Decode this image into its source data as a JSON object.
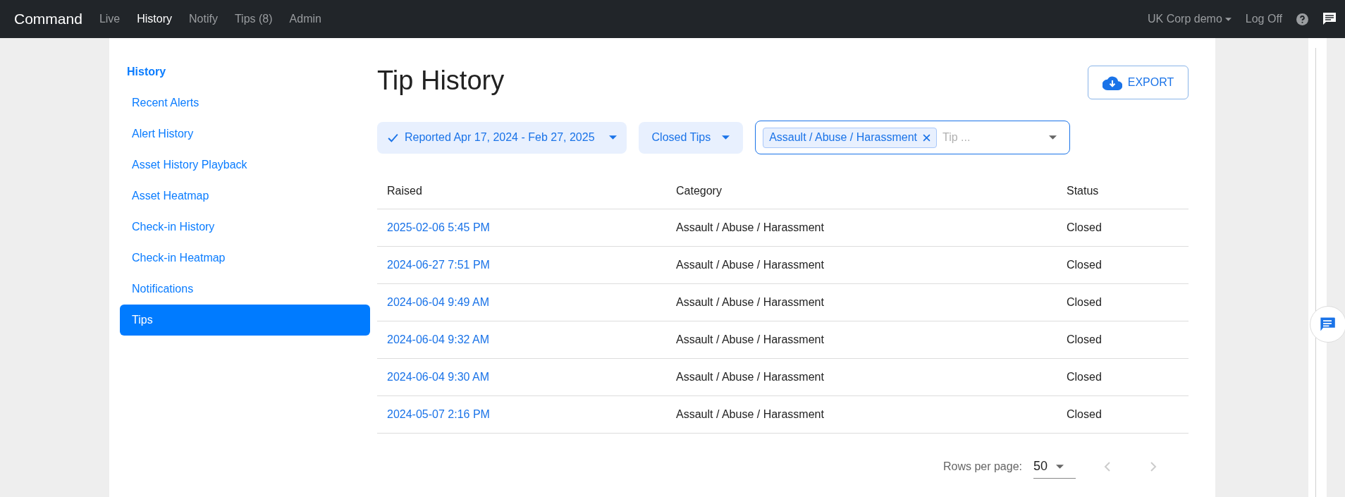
{
  "navbar": {
    "brand": "Command",
    "items": [
      {
        "label": "Live",
        "selected": false
      },
      {
        "label": "History",
        "selected": true
      },
      {
        "label": "Notify",
        "selected": false
      },
      {
        "label": "Tips (8)",
        "selected": false
      },
      {
        "label": "Admin",
        "selected": false
      }
    ],
    "account": "UK Corp demo",
    "logoff": "Log Off"
  },
  "sidebar": {
    "heading": "History",
    "items": [
      {
        "label": "Recent Alerts",
        "selected": false
      },
      {
        "label": "Alert History",
        "selected": false
      },
      {
        "label": "Asset History Playback",
        "selected": false
      },
      {
        "label": "Asset Heatmap",
        "selected": false
      },
      {
        "label": "Check-in History",
        "selected": false
      },
      {
        "label": "Check-in Heatmap",
        "selected": false
      },
      {
        "label": "Notifications",
        "selected": false
      },
      {
        "label": "Tips",
        "selected": true
      }
    ]
  },
  "title": "Tip History",
  "export_button": "EXPORT",
  "filters": {
    "date_range": "Reported Apr 17, 2024 - Feb 27, 2025",
    "status": "Closed Tips",
    "category_tags": [
      "Assault / Abuse / Harassment"
    ],
    "category_placeholder": "Tip ..."
  },
  "table": {
    "columns": [
      "Raised",
      "Category",
      "Status"
    ],
    "rows": [
      [
        "2025-02-06 5:45 PM",
        "Assault / Abuse / Harassment",
        "Closed"
      ],
      [
        "2024-06-27 7:51 PM",
        "Assault / Abuse / Harassment",
        "Closed"
      ],
      [
        "2024-06-04 9:49 AM",
        "Assault / Abuse / Harassment",
        "Closed"
      ],
      [
        "2024-06-04 9:32 AM",
        "Assault / Abuse / Harassment",
        "Closed"
      ],
      [
        "2024-06-04 9:30 AM",
        "Assault / Abuse / Harassment",
        "Closed"
      ],
      [
        "2024-05-07 2:16 PM",
        "Assault / Abuse / Harassment",
        "Closed"
      ]
    ]
  },
  "pagination": {
    "label": "Rows per page:",
    "value": "50"
  }
}
